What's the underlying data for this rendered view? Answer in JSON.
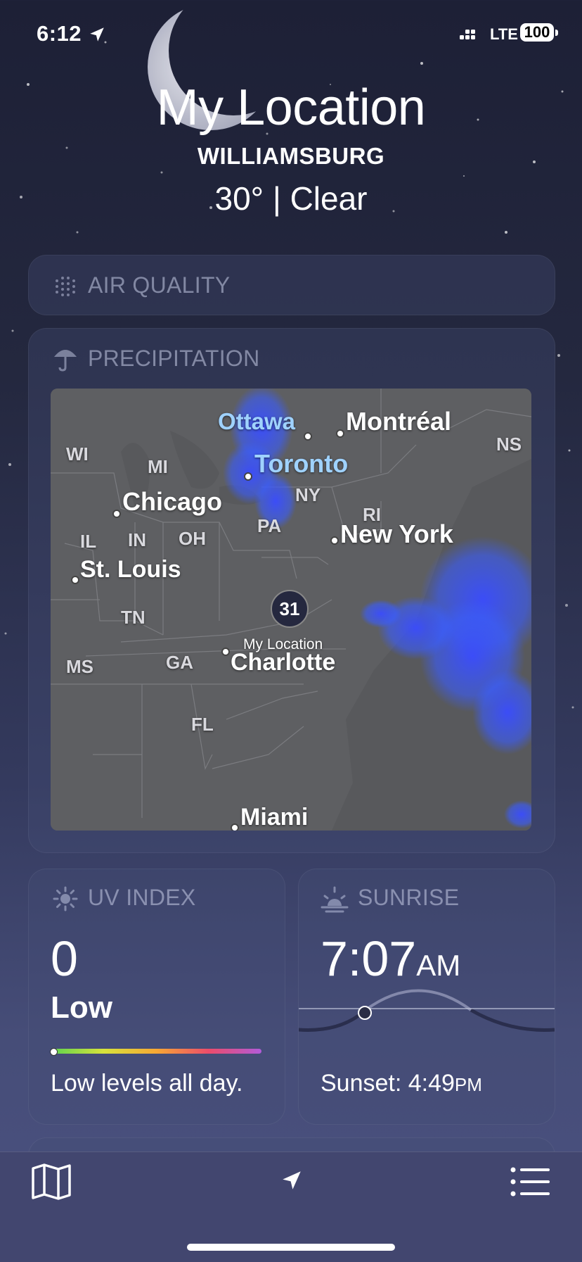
{
  "status_bar": {
    "time": "6:12",
    "network": "LTE",
    "battery": "100"
  },
  "header": {
    "title": "My Location",
    "city": "WILLIAMSBURG",
    "temp_condition": "30° | Clear"
  },
  "air_quality": {
    "label": "AIR QUALITY"
  },
  "precipitation": {
    "label": "PRECIPITATION",
    "map": {
      "cities": [
        "Ottawa",
        "Montréal",
        "Toronto",
        "Chicago",
        "New York",
        "St. Louis",
        "Charlotte",
        "Miami"
      ],
      "states": [
        "WI",
        "MI",
        "NY",
        "NS",
        "RI",
        "IL",
        "IN",
        "OH",
        "PA",
        "TN",
        "MS",
        "GA",
        "FL"
      ],
      "pin_temp": "31",
      "pin_label": "My Location"
    }
  },
  "uv_index": {
    "label": "UV INDEX",
    "value": "0",
    "level": "Low",
    "scale_position": 0,
    "description": "Low levels all day."
  },
  "sunrise": {
    "label": "SUNRISE",
    "time": "7:07",
    "ampm": "AM",
    "sunset_text": "Sunset: 4:49",
    "sunset_ampm": "PM"
  },
  "colors": {
    "background_top": "#1d2036",
    "background_bottom": "#4a5180",
    "map_bg": "#5c5d60",
    "radar_blue": "#3a5cff"
  },
  "icons": {
    "map_tab": "map-icon",
    "location_tab": "location-arrow-icon",
    "list_tab": "list-icon",
    "umbrella": "umbrella-icon",
    "sun": "sun-icon",
    "sunrise": "sunrise-icon",
    "air_quality": "dots-icon"
  }
}
